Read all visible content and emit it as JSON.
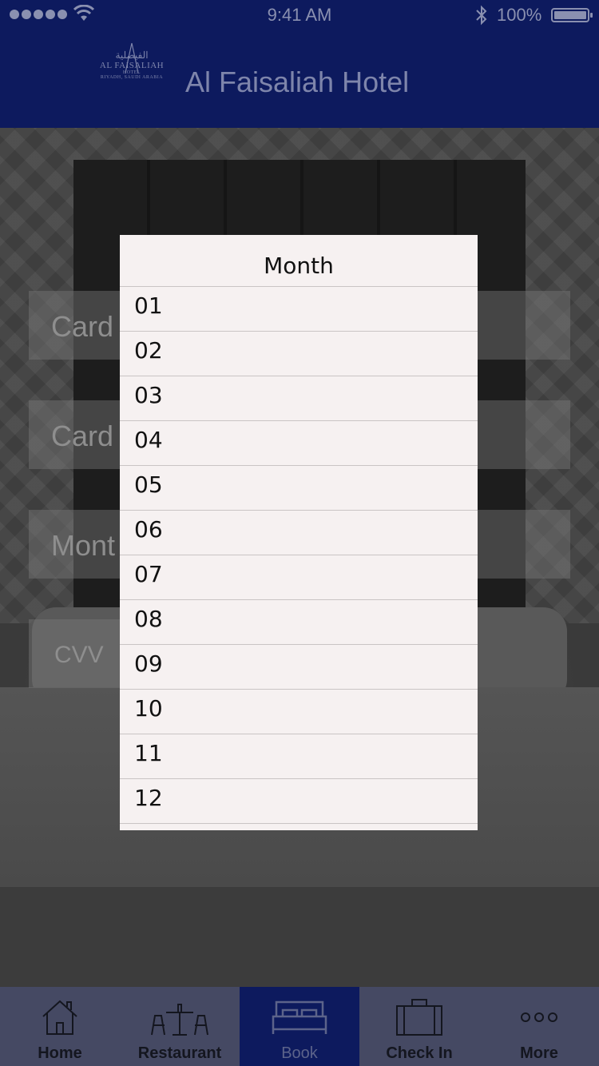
{
  "status_bar": {
    "time": "9:41 AM",
    "battery": "100%"
  },
  "header": {
    "title": "Al Faisaliah Hotel",
    "logo": {
      "arabic": "الفيصلية",
      "name": "AL FAISALIAH",
      "sub": "HOTEL",
      "location": "RIYADH, SAUDI ARABIA"
    }
  },
  "form": {
    "fields": [
      "Card",
      "Card",
      "Mont",
      "CVV"
    ]
  },
  "picker": {
    "title": "Month",
    "options": [
      "01",
      "02",
      "03",
      "04",
      "05",
      "06",
      "07",
      "08",
      "09",
      "10",
      "11",
      "12"
    ]
  },
  "tabbar": {
    "tabs": [
      {
        "label": "Home",
        "icon": "home-icon"
      },
      {
        "label": "Restaurant",
        "icon": "restaurant-icon"
      },
      {
        "label": "Book",
        "icon": "bed-icon",
        "active": true
      },
      {
        "label": "Check In",
        "icon": "suitcase-icon"
      },
      {
        "label": "More",
        "icon": "more-icon"
      }
    ]
  },
  "colors": {
    "header_bg": "#0d1a5e",
    "tabbar_bg": "#454963",
    "picker_bg": "#f6f1f1"
  }
}
